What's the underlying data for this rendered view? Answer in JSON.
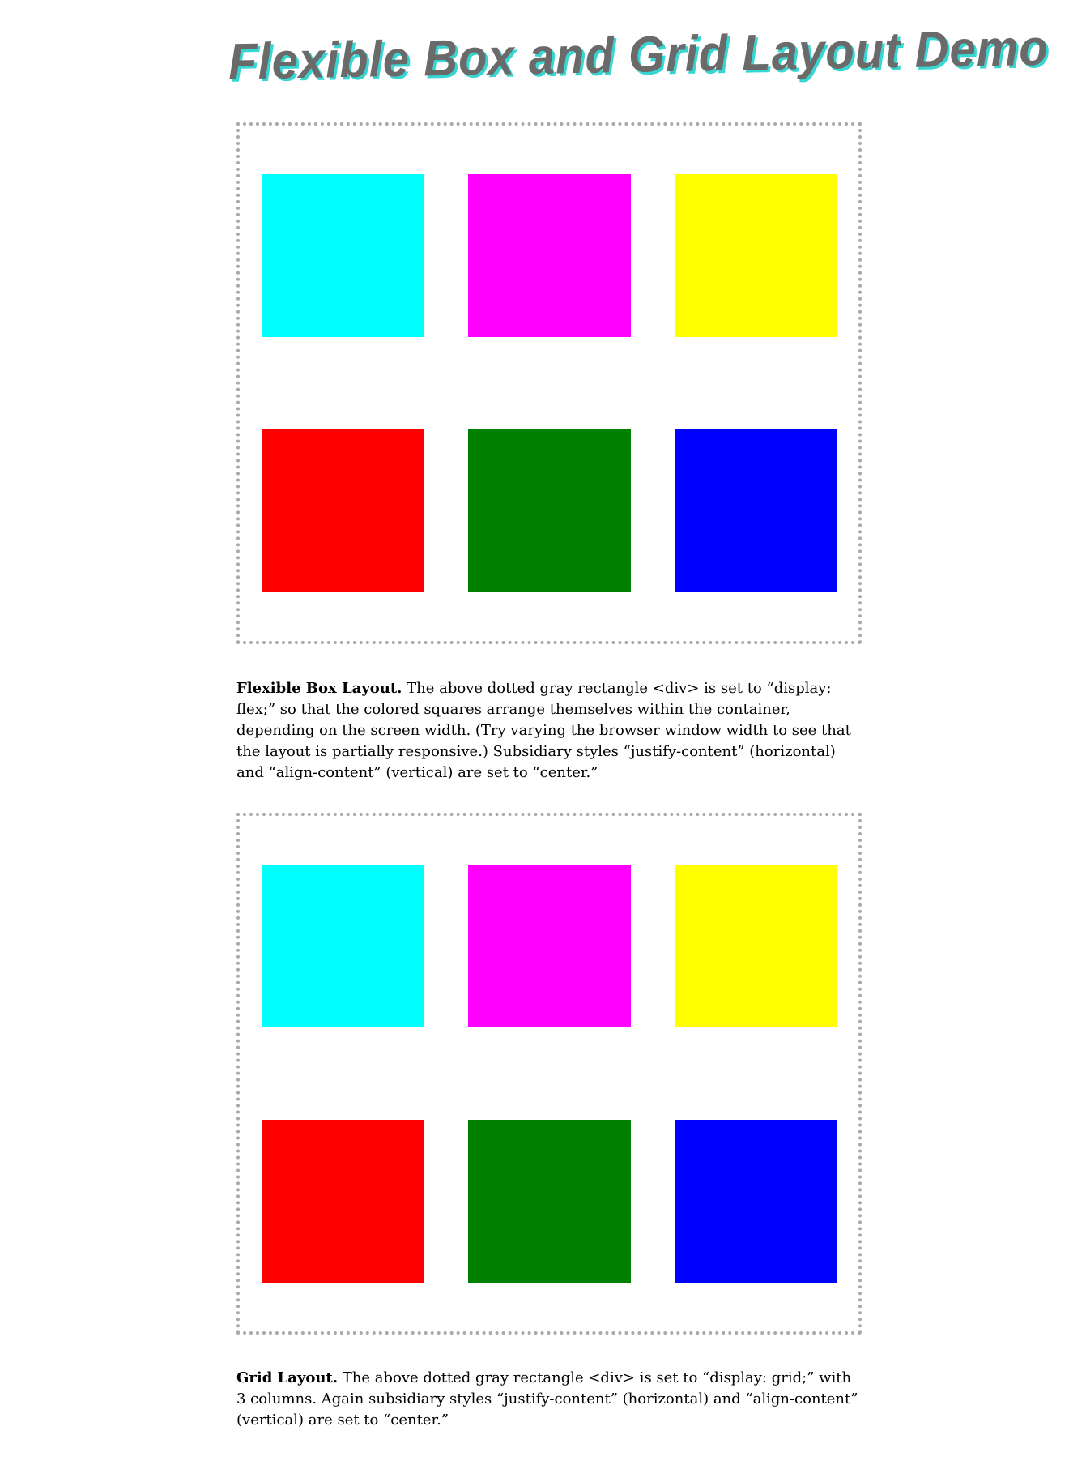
{
  "page": {
    "title": "Flexible Box and Grid Layout Demo",
    "title_color": "#6a6a6a",
    "title_shadow_color": "#38d6d2",
    "container_border_color": "#a9a9a9"
  },
  "flex_demo": {
    "squares": [
      {
        "name": "cyan",
        "color": "#00ffff"
      },
      {
        "name": "magenta",
        "color": "#ff00ff"
      },
      {
        "name": "yellow",
        "color": "#ffff00"
      },
      {
        "name": "red",
        "color": "#ff0000"
      },
      {
        "name": "green",
        "color": "#008000"
      },
      {
        "name": "blue",
        "color": "#0000ff"
      }
    ],
    "label": "Flexible Box Layout.",
    "text": " The above dotted gray rectangle <div> is set to “display: flex;” so that the colored squares arrange themselves within the container, depending on the screen width. (Try varying the browser window width to see that the layout is partially responsive.) Subsidiary styles “justify-content” (horizontal) and “align-content” (vertical) are set to “center.”"
  },
  "grid_demo": {
    "squares": [
      {
        "name": "cyan",
        "color": "#00ffff"
      },
      {
        "name": "magenta",
        "color": "#ff00ff"
      },
      {
        "name": "yellow",
        "color": "#ffff00"
      },
      {
        "name": "red",
        "color": "#ff0000"
      },
      {
        "name": "green",
        "color": "#008000"
      },
      {
        "name": "blue",
        "color": "#0000ff"
      }
    ],
    "label": "Grid Layout.",
    "text": " The above dotted gray rectangle <div> is set to “display: grid;” with 3 columns. Again subsidiary styles “justify-content” (horizontal) and “align-content” (vertical) are set to “center.”"
  }
}
